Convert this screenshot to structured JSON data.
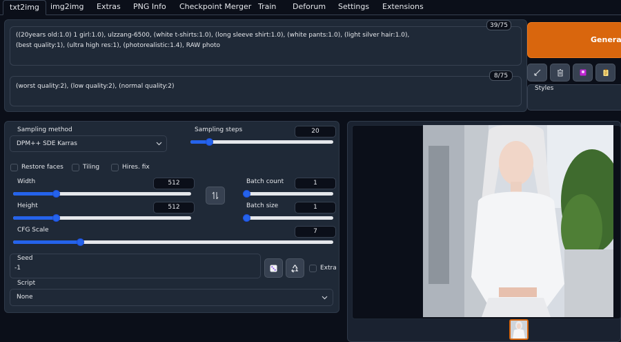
{
  "tabs": [
    {
      "label": "txt2img",
      "active": true
    },
    {
      "label": "img2img"
    },
    {
      "label": "Extras"
    },
    {
      "label": "PNG Info"
    },
    {
      "label": "Checkpoint Merger"
    },
    {
      "label": "Train"
    },
    {
      "label": "Deforum"
    },
    {
      "label": "Settings"
    },
    {
      "label": "Extensions"
    }
  ],
  "prompt": {
    "line1": "((20years old:1.0) 1 girl:1.0), ulzzang-6500, (white t-shirts:1.0), (long sleeve shirt:1.0), (white pants:1.0), (light silver hair:1.0),",
    "line2": "(best quality:1), (ultra high res:1), (photorealistic:1.4), RAW photo",
    "counter": "39/75"
  },
  "negative_prompt": {
    "text": "(worst quality:2), (low quality:2), (normal quality:2)",
    "counter": "8/75"
  },
  "generate_label": "Generate",
  "styles_label": "Styles",
  "sampling": {
    "method_label": "Sampling method",
    "method_value": "DPM++ SDE Karras",
    "steps_label": "Sampling steps",
    "steps_value": "20",
    "steps_fraction": 0.13
  },
  "checkboxes": {
    "restore_faces": "Restore faces",
    "tiling": "Tiling",
    "hires_fix": "Hires. fix"
  },
  "width": {
    "label": "Width",
    "value": "512",
    "fraction": 0.24
  },
  "height": {
    "label": "Height",
    "value": "512",
    "fraction": 0.24
  },
  "batch_count": {
    "label": "Batch count",
    "value": "1",
    "fraction": 0.0
  },
  "batch_size": {
    "label": "Batch size",
    "value": "1",
    "fraction": 0.0
  },
  "cfg": {
    "label": "CFG Scale",
    "value": "7",
    "fraction": 0.21
  },
  "seed": {
    "label": "Seed",
    "value": "-1",
    "extra_label": "Extra"
  },
  "script": {
    "label": "Script",
    "value": "None"
  },
  "colors": {
    "accent": "#2563eb",
    "generate": "#d9660d",
    "background": "#0b0f19",
    "panel": "#1f2937"
  },
  "icons": [
    "swap-icon",
    "dice-icon",
    "recycle-icon",
    "chevron-down-icon",
    "arrow-icon",
    "trash-icon",
    "picture-icon",
    "clipboard-icon"
  ]
}
